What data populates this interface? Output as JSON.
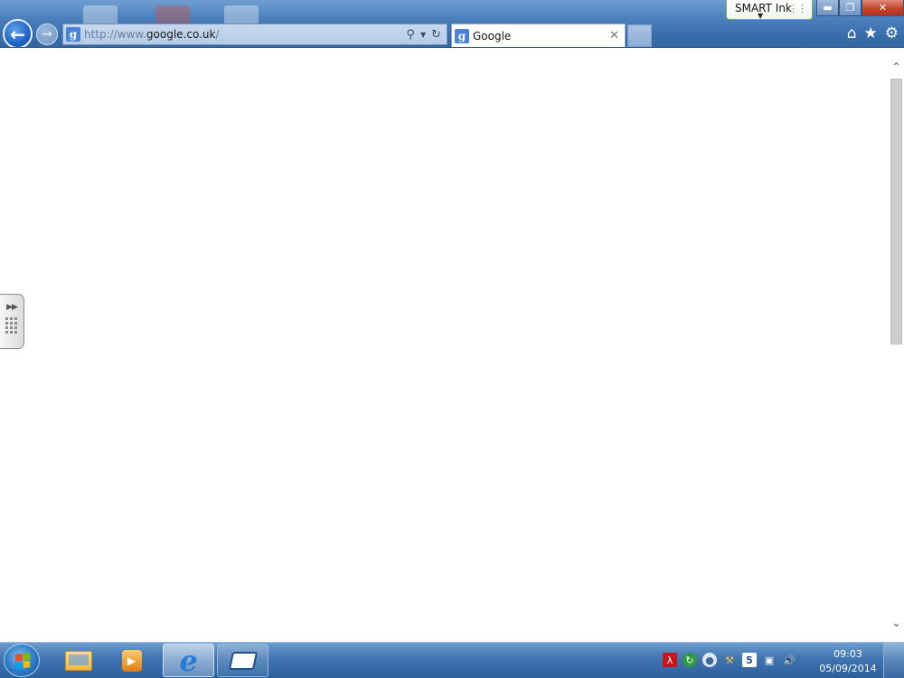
{
  "browser": {
    "address_bar": {
      "url_prefix": "http://www.",
      "url_host": "google.co.uk",
      "url_suffix": "/"
    },
    "tab": {
      "title": "Google",
      "favicon_letter": "g"
    },
    "smart_ink": {
      "label": "SMART Ink"
    }
  },
  "taskbar": {
    "pinned": [
      {
        "name": "windows-explorer",
        "icon": "folder-icon"
      },
      {
        "name": "windows-media-player",
        "icon": "media-player-icon"
      },
      {
        "name": "internet-explorer",
        "icon": "ie-icon",
        "active": true
      },
      {
        "name": "smart-notebook",
        "icon": "smart-board-icon"
      }
    ],
    "tray_icons": [
      "adobe-reader-icon",
      "sync-icon",
      "disc-icon",
      "network-tools-icon",
      "html5-icon",
      "network-icon",
      "volume-icon"
    ],
    "clock": {
      "time": "09:03",
      "date": "05/09/2014"
    }
  },
  "colors": {
    "chrome_blue": "#4f83bf",
    "taskbar_blue": "#3f74b0",
    "close_red": "#c6412a",
    "smart_ink_border": "#7ab25a"
  }
}
